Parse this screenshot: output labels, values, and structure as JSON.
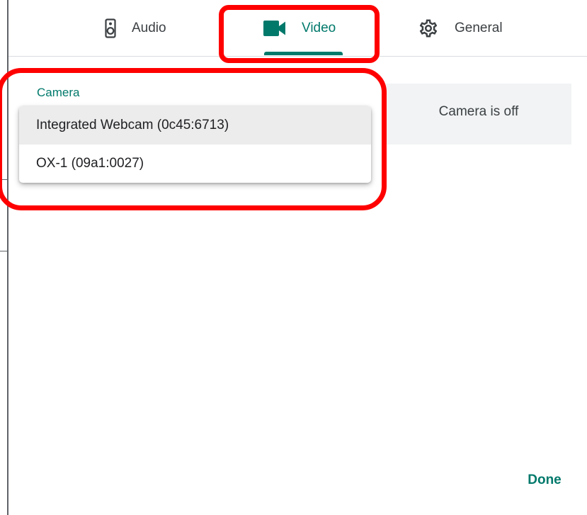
{
  "tabs": [
    {
      "label": "Audio",
      "icon": "speaker-icon",
      "active": false
    },
    {
      "label": "Video",
      "icon": "videocam-icon",
      "active": true
    },
    {
      "label": "General",
      "icon": "gear-icon",
      "active": false
    }
  ],
  "video": {
    "camera_label": "Camera",
    "camera_options": [
      {
        "label": "Integrated Webcam (0c45:6713)",
        "selected": true
      },
      {
        "label": "OX-1 (09a1:0027)",
        "selected": false
      }
    ],
    "preview_text": "Camera is off"
  },
  "footer": {
    "done_label": "Done"
  },
  "colors": {
    "accent": "#00796b",
    "highlight": "#ff0000",
    "preview_bg": "#f1f3f4"
  }
}
